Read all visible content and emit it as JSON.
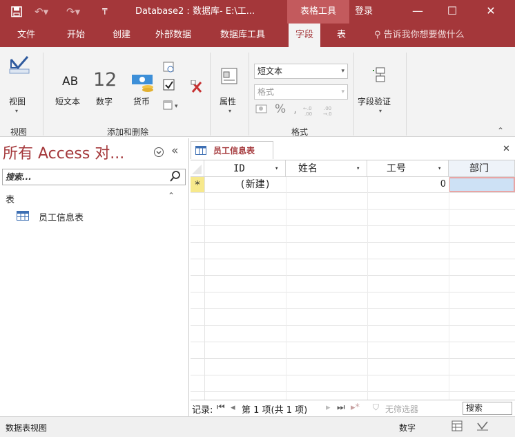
{
  "titlebar": {
    "title": "Database2 : 数据库- E:\\工...",
    "context_tab": "表格工具",
    "signin": "登录"
  },
  "ribbon_tabs": [
    {
      "label": "文件"
    },
    {
      "label": "开始"
    },
    {
      "label": "创建"
    },
    {
      "label": "外部数据"
    },
    {
      "label": "数据库工具"
    },
    {
      "label": "字段",
      "active": true
    },
    {
      "label": "表"
    }
  ],
  "tellme": "告诉我你想要做什么",
  "ribbon": {
    "view_label": "视图",
    "ab_text": "AB",
    "num_text": "12",
    "short_text": "短文本",
    "number": "数字",
    "currency": "货币",
    "properties": "属性",
    "datatype_value": "短文本",
    "format_placeholder": "格式",
    "percent": "%",
    "comma": ",",
    "validation": "字段验证",
    "groups": {
      "view": "视图",
      "add_delete": "添加和删除",
      "format": "格式"
    }
  },
  "nav": {
    "title": "所有 Access 对...",
    "search_placeholder": "搜索...",
    "section": "表",
    "items": [
      {
        "label": "员工信息表"
      }
    ]
  },
  "document": {
    "tab_label": "员工信息表",
    "columns": [
      {
        "label": "ID"
      },
      {
        "label": "姓名"
      },
      {
        "label": "工号"
      },
      {
        "label": "部门"
      }
    ],
    "new_row": {
      "marker": "*",
      "id": "(新建)",
      "gonghao": "0"
    }
  },
  "recordnav": {
    "label": "记录:",
    "position": "第 1 项(共 1 项)",
    "filter": "无筛选器",
    "search": "搜索"
  },
  "status": {
    "left": "数据表视图",
    "mode": "数字"
  },
  "colors": {
    "accent": "#a4373a",
    "context": "#c35a5d",
    "ribbon_bg": "#f3f3f3",
    "selected_cell": "#cde1f5",
    "selected_border": "#e8a5a5"
  }
}
